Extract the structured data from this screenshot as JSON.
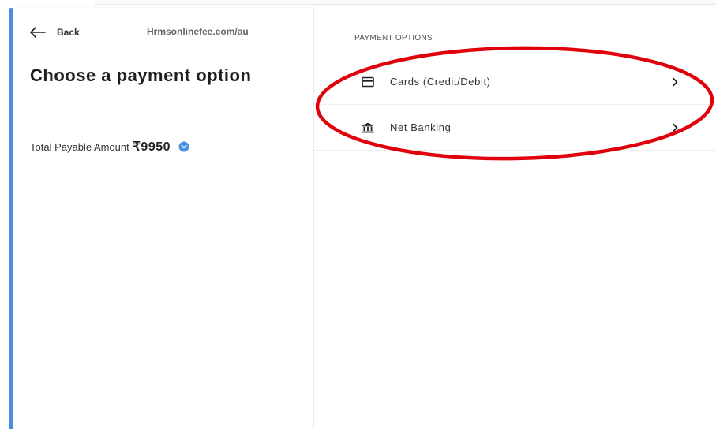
{
  "header": {
    "back_label": "Back",
    "site_url": "Hrmsonlinefee.com/au",
    "back_icon": "arrow-left-icon"
  },
  "left": {
    "title": "Choose a payment option",
    "amount_label": "Total Payable Amount",
    "amount_value": "₹9950",
    "info_icon": "info-chevron-icon"
  },
  "payment": {
    "section_label": "PAYMENT OPTIONS",
    "options": [
      {
        "label": "Cards (Credit/Debit)",
        "icon": "card-icon"
      },
      {
        "label": "Net Banking",
        "icon": "bank-icon"
      }
    ]
  },
  "colors": {
    "accent": "#4a90e2",
    "annotation": "#e0000b"
  }
}
